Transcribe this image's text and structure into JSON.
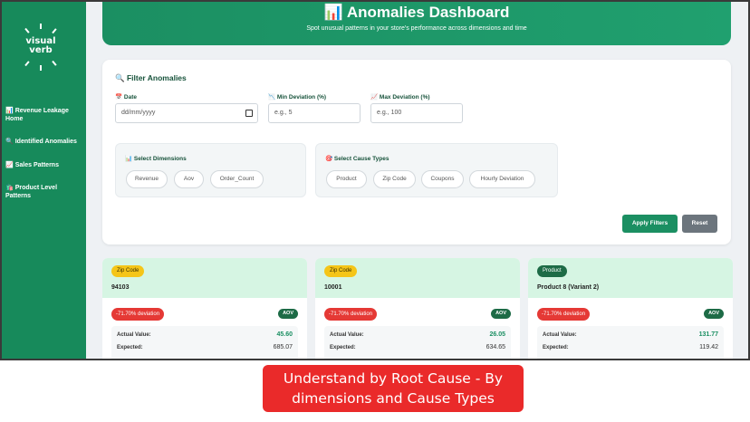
{
  "sidebar": {
    "logo_text": "visual\nverb",
    "items": [
      {
        "icon": "📊",
        "label": "Revenue Leakage Home",
        "icon_name": "chart-icon"
      },
      {
        "icon": "🔍",
        "label": "Identified Anomalies",
        "icon_name": "magnifier-icon"
      },
      {
        "icon": "📈",
        "label": "Sales Patterns",
        "icon_name": "trend-icon"
      },
      {
        "icon": "🛍️",
        "label": "Product Level Patterns",
        "icon_name": "shopping-bags-icon"
      }
    ]
  },
  "header": {
    "icon": "📊",
    "title": "Anomalies Dashboard",
    "subtitle": "Spot unusual patterns in your store's performance across dimensions and time"
  },
  "filters": {
    "title": "🔍 Filter Anomalies",
    "date": {
      "label": "📅 Date",
      "value": "dd/mm/yyyy"
    },
    "min_dev": {
      "label": "📉 Min Deviation (%)",
      "placeholder": "e.g., 5"
    },
    "max_dev": {
      "label": "📈 Max Deviation (%)",
      "placeholder": "e.g., 100"
    },
    "dimensions": {
      "title": "📊 Select Dimensions",
      "options": [
        "Revenue",
        "Aov",
        "Order_Count"
      ]
    },
    "causes": {
      "title": "🎯 Select Cause Types",
      "options": [
        "Product",
        "Zip Code",
        "Coupons",
        "Hourly Deviation"
      ]
    },
    "apply_label": "Apply Filters",
    "reset_label": "Reset"
  },
  "cards": [
    {
      "tag": "Zip Code",
      "tag_style": "yellow",
      "name": "94103",
      "deviation": "-71.70% deviation",
      "metric": "AOV",
      "actual_label": "Actual Value:",
      "actual": "45.60",
      "expected_label": "Expected:",
      "expected": "685.07"
    },
    {
      "tag": "Zip Code",
      "tag_style": "yellow",
      "name": "10001",
      "deviation": "-71.70% deviation",
      "metric": "AOV",
      "actual_label": "Actual Value:",
      "actual": "26.05",
      "expected_label": "Expected:",
      "expected": "634.65"
    },
    {
      "tag": "Product",
      "tag_style": "green",
      "name": "Product 8 (Variant 2)",
      "deviation": "-71.70% deviation",
      "metric": "AOV",
      "actual_label": "Actual Value:",
      "actual": "131.77",
      "expected_label": "Expected:",
      "expected": "119.42"
    }
  ],
  "caption": {
    "line1": "Understand by Root Cause - By",
    "line2": "dimensions and Cause Types"
  },
  "colors": {
    "primary": "#178a5b",
    "danger": "#e53935",
    "caption_bg": "#ea2a2a",
    "reset": "#6c757d"
  }
}
